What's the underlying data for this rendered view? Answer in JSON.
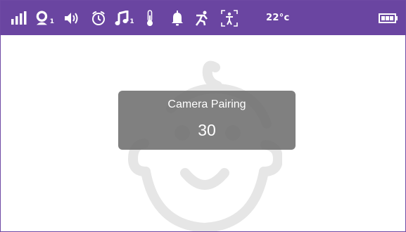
{
  "status_bar": {
    "background_color": "#6a45a1",
    "icon_color": "#ffffff",
    "temperature": "22°c",
    "camera_index": "1",
    "music_index": "1",
    "icons": [
      "signal-strength-icon",
      "camera-icon",
      "volume-icon",
      "alarm-clock-icon",
      "music-icon",
      "thermometer-icon",
      "bell-icon",
      "motion-icon",
      "zoom-icon",
      "battery-icon"
    ]
  },
  "dialog": {
    "title": "Camera Pairing",
    "countdown": "30",
    "background_color": "#6e6e6e"
  },
  "background_graphic": {
    "icon": "baby-face-icon",
    "color": "#e6e6e6"
  }
}
